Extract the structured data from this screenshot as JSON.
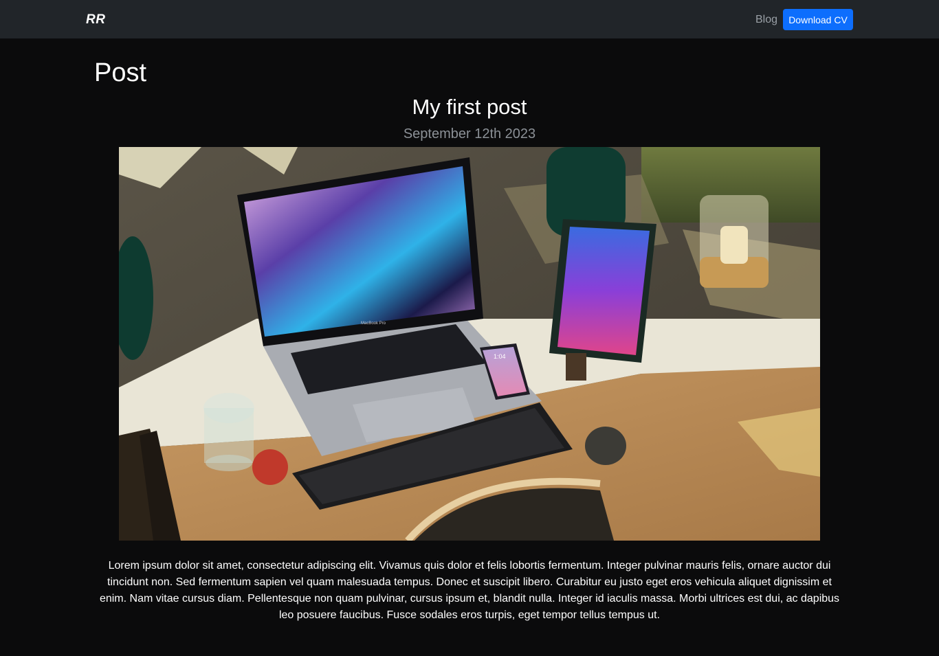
{
  "navbar": {
    "brand": "RR",
    "blog_link": "Blog",
    "cv_button": "Download CV"
  },
  "page": {
    "heading": "Post"
  },
  "post": {
    "title": "My first post",
    "date": "September 12th 2023",
    "image_alt": "Desk with laptop, tablet, phone and keyboard",
    "body": "Lorem ipsum dolor sit amet, consectetur adipiscing elit. Vivamus quis dolor et felis lobortis fermentum. Integer pulvinar mauris felis, ornare auctor dui tincidunt non. Sed fermentum sapien vel quam malesuada tempus. Donec et suscipit libero. Curabitur eu justo eget eros vehicula aliquet dignissim et enim. Nam vitae cursus diam. Pellentesque non quam pulvinar, cursus ipsum et, blandit nulla. Integer id iaculis massa. Morbi ultrices est dui, ac dapibus leo posuere faucibus. Fusce sodales eros turpis, eget tempor tellus tempus ut.",
    "laptop_label": "MacBook Pro",
    "phone_time": "1:04"
  },
  "colors": {
    "navbar_bg": "#212529",
    "page_bg": "#0b0b0c",
    "accent": "#0d6efd",
    "muted": "#8c9197"
  }
}
